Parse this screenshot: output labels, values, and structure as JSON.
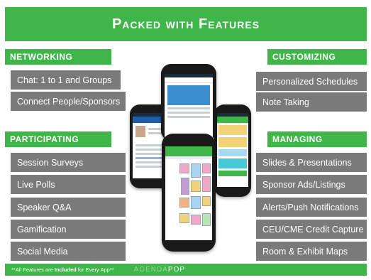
{
  "title": "Packed with Features",
  "sections": {
    "networking": {
      "heading": "NETWORKING",
      "items": [
        "Chat: 1 to 1 and Groups",
        "Connect People/Sponsors"
      ]
    },
    "participating": {
      "heading": "PARTICIPATING",
      "items": [
        "Session Surveys",
        "Live Polls",
        "Speaker Q&A",
        "Gamification",
        "Social Media"
      ]
    },
    "customizing": {
      "heading": "CUSTOMIZING",
      "items": [
        "Personalized Schedules",
        "Note Taking"
      ]
    },
    "managing": {
      "heading": "MANAGING",
      "items": [
        "Slides & Presentations",
        "Sponsor Ads/Listings",
        "Alerts/Push Notifications",
        "CEU/CME Credit Capture",
        "Room & Exhibit Maps"
      ]
    }
  },
  "footer": {
    "note_prefix": "**All Features are ",
    "note_bold": "Included",
    "note_suffix": " for Every App**",
    "logo_light": "AGENDA",
    "logo_strong": "POP"
  },
  "colors": {
    "accent": "#3fb54a",
    "feature_bg": "#7a7a7a",
    "text": "#ffffff"
  },
  "phones": [
    "left-phone",
    "center-back-phone",
    "center-front-phone",
    "right-phone"
  ]
}
